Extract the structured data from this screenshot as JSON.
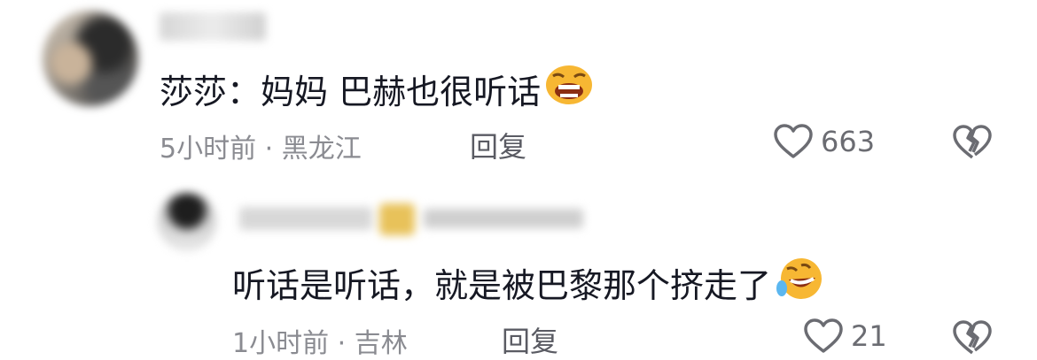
{
  "comments": [
    {
      "author_name": "",
      "text": "莎莎：妈妈 巴赫也很听话",
      "emoji": "laughing-face",
      "time": "5小时前",
      "separator": "·",
      "location": "黑龙江",
      "reply_label": "回复",
      "likes": "663"
    },
    {
      "author_name": "",
      "text": "听话是听话，就是被巴黎那个挤走了",
      "emoji": "rolling-on-floor-laughing-face",
      "time": "1小时前",
      "separator": "·",
      "location": "吉林",
      "reply_label": "回复",
      "likes": "21"
    }
  ],
  "colors": {
    "text": "#161823",
    "meta": "#8a8b91",
    "icon": "#6b6c72"
  }
}
